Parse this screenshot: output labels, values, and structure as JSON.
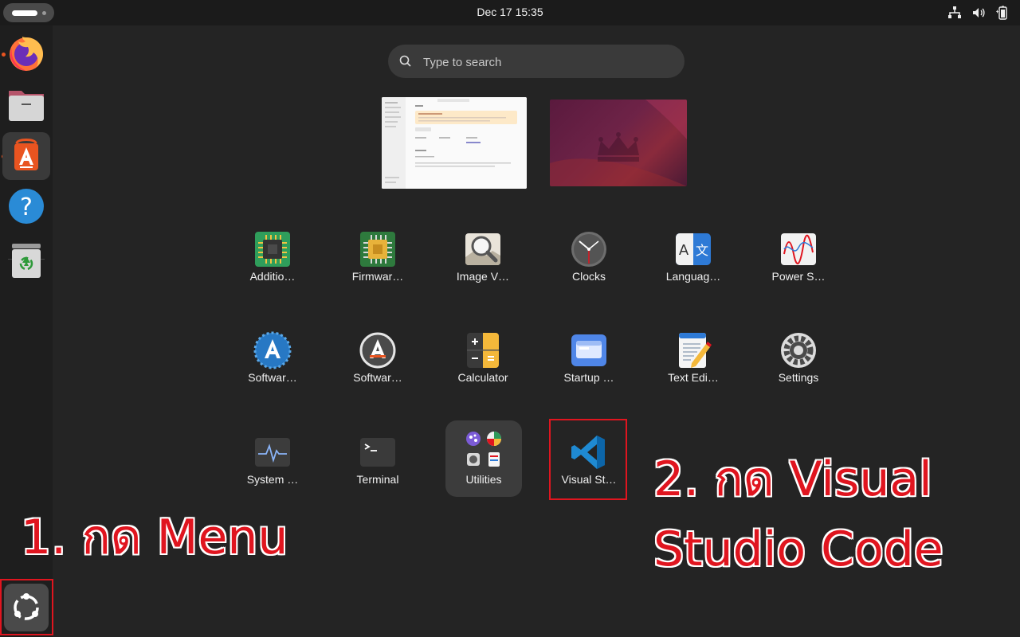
{
  "topbar": {
    "clock": "Dec 17  15:35",
    "tray_icons": [
      "network-icon",
      "volume-icon",
      "battery-icon"
    ]
  },
  "dock": {
    "items": [
      {
        "name": "firefox",
        "icon": "firefox-icon",
        "running": true
      },
      {
        "name": "files",
        "icon": "files-icon",
        "running": false
      },
      {
        "name": "app-center",
        "icon": "app-center-icon",
        "running": true,
        "active": true
      },
      {
        "name": "help",
        "icon": "help-icon",
        "running": false
      },
      {
        "name": "trash",
        "icon": "trash-icon",
        "running": false
      }
    ],
    "show_apps_icon": "ubuntu-logo-icon"
  },
  "search": {
    "placeholder": "Type to search"
  },
  "apps": {
    "row1": [
      "Additio…",
      "Firmwar…",
      "Image V…",
      "Clocks",
      "Languag…",
      "Power S…"
    ],
    "row2": [
      "Softwar…",
      "Softwar…",
      "Calculator",
      "Startup …",
      "Text Edi…",
      "Settings"
    ],
    "row3": [
      "System …",
      "Terminal",
      "Utilities",
      "Visual St…"
    ]
  },
  "annotations": {
    "step1": "1. กด Menu",
    "step2_line1": "2. กด Visual",
    "step2_line2": "Studio Code"
  },
  "colors": {
    "accent": "#e95420",
    "highlight_box": "#e0151f",
    "background": "#242424"
  }
}
